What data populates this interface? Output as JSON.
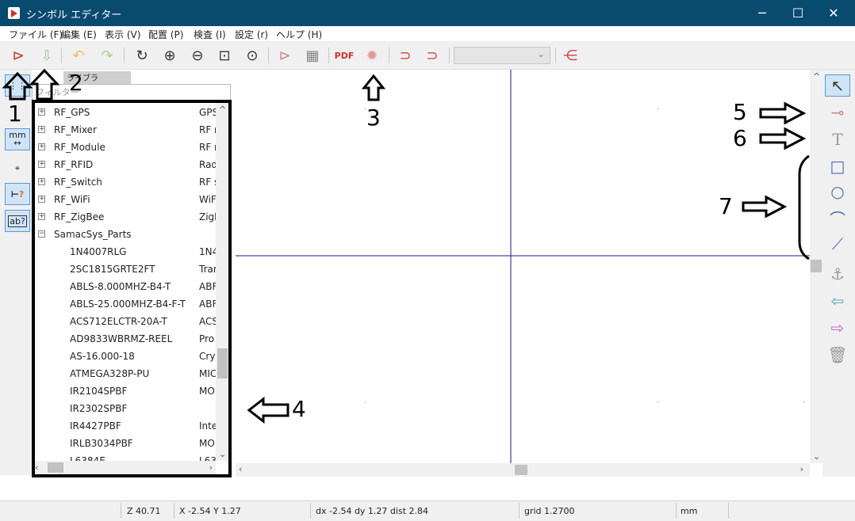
{
  "window": {
    "title": "シンボル エディター",
    "minimize": "─",
    "maximize": "☐",
    "close": "✕"
  },
  "menubar": [
    "ファイル (F)",
    "編集 (E)",
    "表示 (V)",
    "配置 (P)",
    "検査 (I)",
    "設定 (r)",
    "ヘルプ (H)"
  ],
  "toolbar": {
    "unit_combo_value": ""
  },
  "left_toolbar": {
    "units_label": "mm"
  },
  "library": {
    "header": "ライブラ",
    "filter_placeholder": "フィルター",
    "rows": [
      {
        "type": "lib",
        "expander": "+",
        "name": "RF_GPS",
        "desc": "GPS"
      },
      {
        "type": "lib",
        "expander": "+",
        "name": "RF_Mixer",
        "desc": "RF r"
      },
      {
        "type": "lib",
        "expander": "+",
        "name": "RF_Module",
        "desc": "RF r"
      },
      {
        "type": "lib",
        "expander": "+",
        "name": "RF_RFID",
        "desc": "Rad"
      },
      {
        "type": "lib",
        "expander": "+",
        "name": "RF_Switch",
        "desc": "RF s"
      },
      {
        "type": "lib",
        "expander": "+",
        "name": "RF_WiFi",
        "desc": "WiF"
      },
      {
        "type": "lib",
        "expander": "+",
        "name": "RF_ZigBee",
        "desc": "Zigl"
      },
      {
        "type": "lib",
        "expander": "−",
        "name": "SamacSys_Parts",
        "desc": ""
      },
      {
        "type": "part",
        "name": "1N4007RLG",
        "desc": "1N4"
      },
      {
        "type": "part",
        "name": "2SC1815GRTE2FT",
        "desc": "Trar"
      },
      {
        "type": "part",
        "name": "ABLS-8.000MHZ-B4-T",
        "desc": "ABF"
      },
      {
        "type": "part",
        "name": "ABLS-25.000MHZ-B4-F-T",
        "desc": "ABF"
      },
      {
        "type": "part",
        "name": "ACS712ELCTR-20A-T",
        "desc": "ACS"
      },
      {
        "type": "part",
        "name": "AD9833WBRMZ-REEL",
        "desc": "Pro"
      },
      {
        "type": "part",
        "name": "AS-16.000-18",
        "desc": "Crys"
      },
      {
        "type": "part",
        "name": "ATMEGA328P-PU",
        "desc": "MIC"
      },
      {
        "type": "part",
        "name": "IR2104SPBF",
        "desc": "MO"
      },
      {
        "type": "part",
        "name": "IR2302SPBF",
        "desc": ""
      },
      {
        "type": "part",
        "name": "IR4427PBF",
        "desc": "Inte"
      },
      {
        "type": "part",
        "name": "IRLB3034PBF",
        "desc": "MO"
      },
      {
        "type": "part",
        "name": "L6384E",
        "desc": "L63"
      }
    ]
  },
  "statusbar": {
    "zoom": "Z 40.71",
    "cursor": "X -2.54  Y 1.27",
    "delta": "dx -2.54  dy 1.27  dist 2.84",
    "grid": "grid 1.2700",
    "units": "mm"
  },
  "callouts": [
    "1",
    "2",
    "3",
    "4",
    "5",
    "6",
    "7"
  ],
  "colors": {
    "titlebar": "#094a6f",
    "crosshair": "#1a1a8a",
    "callout": "#000000"
  }
}
